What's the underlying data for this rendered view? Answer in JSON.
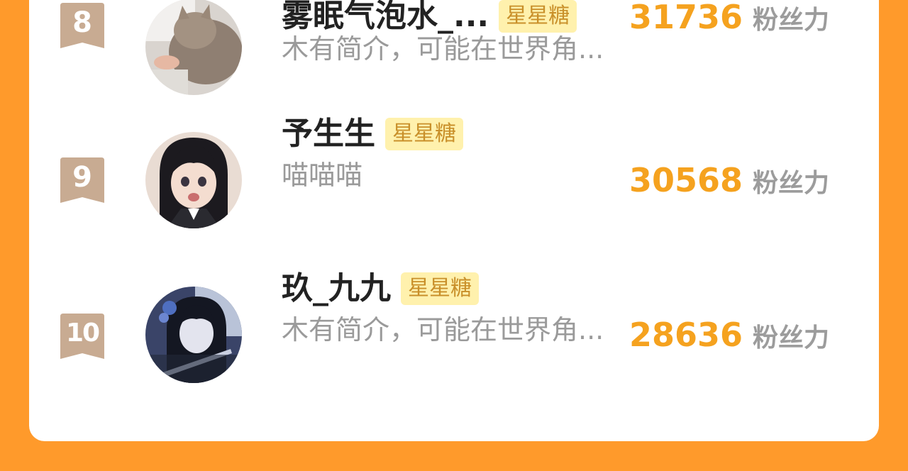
{
  "rankings": [
    {
      "rank": "8",
      "name": "雾眠气泡水_...",
      "badge": "星星糖",
      "bio": "木有简介，可能在世界角...",
      "score": "31736",
      "score_unit": "粉丝力",
      "avatar_desc": "cat-photo-avatar"
    },
    {
      "rank": "9",
      "name": "予生生",
      "badge": "星星糖",
      "bio": "喵喵喵",
      "score": "30568",
      "score_unit": "粉丝力",
      "avatar_desc": "anime-girl-avatar"
    },
    {
      "rank": "10",
      "name": "玖_九九",
      "badge": "星星糖",
      "bio": "木有简介，可能在世界角...",
      "score": "28636",
      "score_unit": "粉丝力",
      "avatar_desc": "anime-sword-avatar"
    }
  ],
  "colors": {
    "background": "#ff9a2b",
    "score": "#f5a21f",
    "badge_bg": "#fff1ad",
    "badge_text": "#c9902a",
    "rank_ribbon": "#c8ab92"
  }
}
